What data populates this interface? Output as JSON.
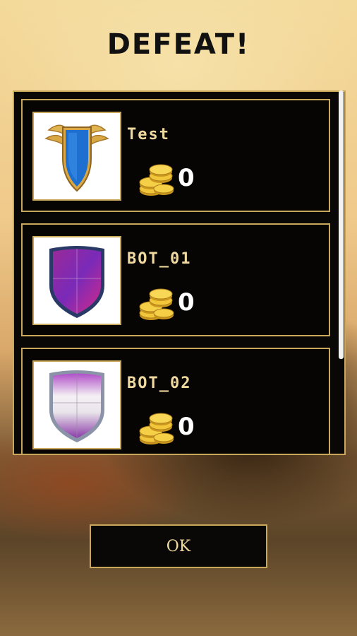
{
  "screen": {
    "title": "DEFEAT!"
  },
  "players": [
    {
      "name": "Test",
      "coins": "0",
      "shield_icon": "winged-blue-shield-icon"
    },
    {
      "name": "BOT_01",
      "coins": "0",
      "shield_icon": "magenta-purple-shield-icon"
    },
    {
      "name": "BOT_02",
      "coins": "0",
      "shield_icon": "white-violet-shield-icon"
    }
  ],
  "coins_icon": "gold-coins-icon",
  "ok_button": {
    "label": "OK"
  },
  "colors": {
    "gold_border": "#c9a85c",
    "name_text": "#f0d9a0",
    "panel_bg": "#0a0806"
  }
}
